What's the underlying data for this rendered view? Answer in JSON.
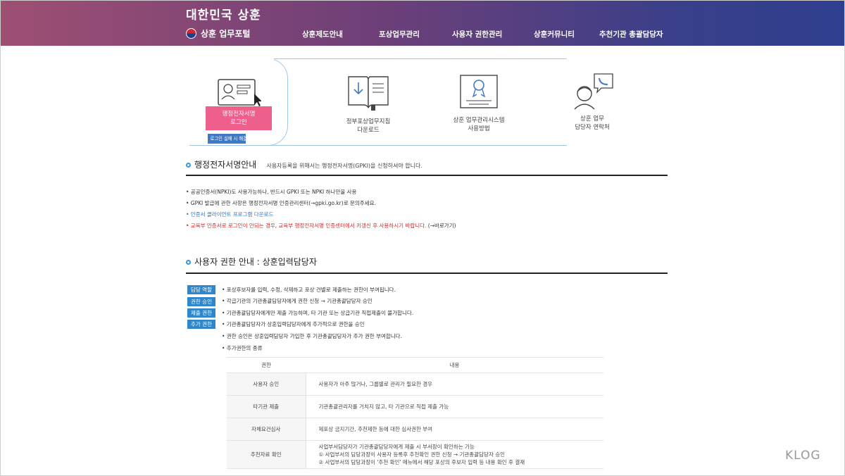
{
  "header": {
    "site_title": "대한민국 상훈",
    "portal_name": "상훈 업무포털",
    "nav": [
      "상훈제도안내",
      "포상업무관리",
      "사용자 권한관리",
      "상훈커뮤니티",
      "추천기관 총괄담당자"
    ]
  },
  "hero": {
    "login_button": [
      "행정전자서명",
      "로그인"
    ],
    "fail_button": "로그인 실패 시 해결방법",
    "tiles": [
      {
        "lines": [
          "정부포상업무지침",
          "다운로드"
        ],
        "icon": "book-icon"
      },
      {
        "lines": [
          "상훈 업무관리시스템",
          "사용방법"
        ],
        "icon": "certificate-icon"
      },
      {
        "lines": [
          "상훈 업무",
          "담당자 연락처"
        ],
        "icon": "phone-person-icon"
      }
    ]
  },
  "section1": {
    "title": "행정전자서명안내",
    "desc": "사용자등록을 위해서는 행정전자서명(GPKI)을 신청하셔야 합니다.",
    "bullets": [
      "• 공공인증서(NPKI)도 사용가능하나, 반드시 GPKI 또는 NPKI 하나만을 사용",
      "• GPKI 발급에 관한 사항은 행정전자서명 인증관리센터(→gpki.go.kr)로 문의주세요.",
      "• 인증서 클라이언트 프로그램 다운로드",
      "• 교육부 인증서로 로그인이 안되는 경우, 교육부 행정전자서명 인증센터에서 키갱신 후 사용하시기 바랍니다.",
      "(→바로가기)"
    ]
  },
  "section2": {
    "title": "사용자 권한 안내 : 상훈입력담당자",
    "tags": [
      "담당 역할",
      "권한 승인",
      "제출 권한",
      "추가 권한"
    ],
    "lines": [
      "• 포상후보자를 입력, 수정, 삭제하고 포상 건별로 제출하는 권한이 부여됩니다.",
      "• 각급기관의 기관총괄담당자에게 권한 신청 → 기관총괄담당자 승인",
      "• 기관총괄담당자에게만 제출 가능하며, 타 기관 또는 상급기관 직접제출이 불가합니다.",
      "• 기관총괄담당자가 상훈입력담당자에게 추가적으로 권한을 승인",
      "• 권한 승인은 상훈입력담당자 가입한 후 기관총괄담당자가 추가 권한 부여합니다.",
      "• 추가권한의 종류"
    ],
    "table": {
      "headers": [
        "권한",
        "내용"
      ],
      "rows": [
        {
          "name": "사용자 승인",
          "content": [
            "사용자가 아주 많거나, 그룹별로 관리가 필요한 경우"
          ]
        },
        {
          "name": "타기관 제출",
          "content": [
            "기관총괄관리자를 거치지 않고, 타 기관으로 직접 제출 가능"
          ]
        },
        {
          "name": "자체요건심사",
          "content": [
            "제포상 금지기간, 추천제한 등에 대한 심사권한 부여"
          ]
        },
        {
          "name": "추천자료 확인",
          "content": [
            "사업부서담당자가 기관총괄담당자에게 제출 시 부서장이 확인하는 기능",
            "① 사업부서의 담당과장이 사용자 등록후 추천확인 권한 신청 → 기관총괄담당자 승인",
            "② 사업부서의 담당과장이 '추천 확인' 메뉴에서 해당 포상의 후보자 입력 등 내용 확인 후 결재"
          ]
        }
      ]
    }
  },
  "watermark": "KLOG"
}
